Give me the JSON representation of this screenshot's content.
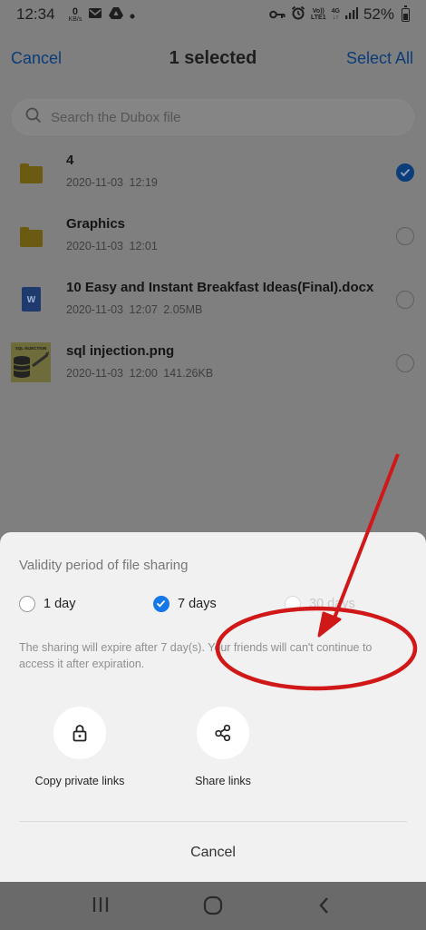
{
  "status_bar": {
    "time": "12:34",
    "net_speed_value": "0",
    "net_speed_unit": "KB/s",
    "volte": "Vo))",
    "lte": "LTE1",
    "network": "4G",
    "battery": "52%"
  },
  "header": {
    "cancel_label": "Cancel",
    "title": "1 selected",
    "select_all_label": "Select All"
  },
  "search": {
    "placeholder": "Search the Dubox file"
  },
  "files": [
    {
      "name": "4",
      "date": "2020-11-03",
      "time": "12:19",
      "size": "",
      "type": "folder",
      "selected": true
    },
    {
      "name": "Graphics",
      "date": "2020-11-03",
      "time": "12:01",
      "size": "",
      "type": "folder",
      "selected": false
    },
    {
      "name": "10 Easy and Instant Breakfast Ideas(Final).docx",
      "date": "2020-11-03",
      "time": "12:07",
      "size": "2.05MB",
      "type": "docx",
      "selected": false
    },
    {
      "name": "sql injection.png",
      "date": "2020-11-03",
      "time": "12:00",
      "size": "141.26KB",
      "type": "image",
      "selected": false
    }
  ],
  "file_icons": {
    "doc_letter": "W",
    "image_caption": "SQL INJECTION"
  },
  "share_sheet": {
    "title": "Validity period of file sharing",
    "options": [
      {
        "label": "1 day",
        "selected": false
      },
      {
        "label": "7 days",
        "selected": true
      },
      {
        "label": "30 days",
        "selected": false
      }
    ],
    "notice": "The sharing will expire after 7 day(s). Your friends will can't continue to access it after expiration.",
    "copy_private_links_label": "Copy private links",
    "share_links_label": "Share links",
    "cancel_label": "Cancel"
  },
  "colors": {
    "accent_blue": "#1677e8",
    "annotation_red": "#d01818"
  }
}
